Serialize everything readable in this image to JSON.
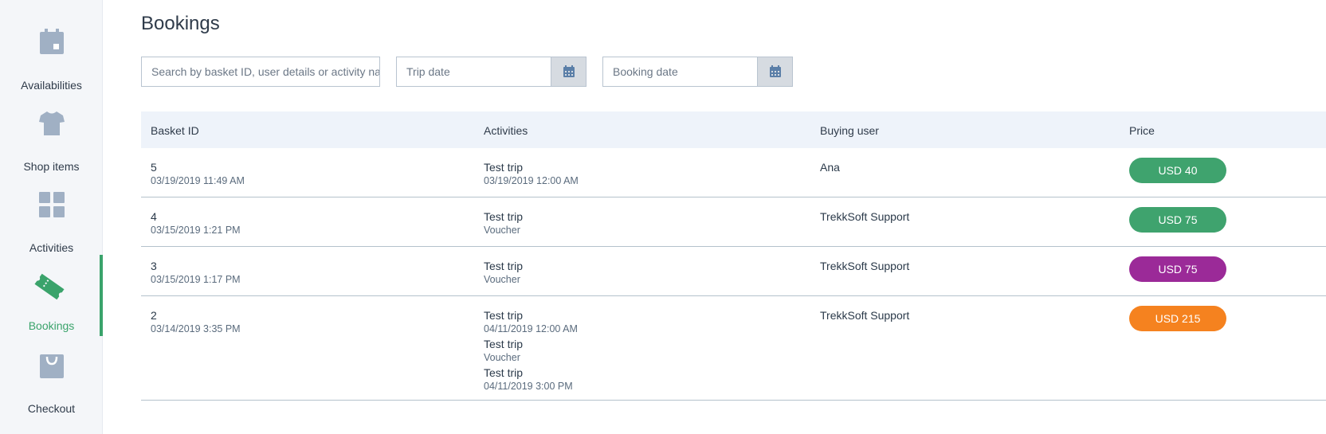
{
  "sidebar": {
    "items": [
      {
        "label": "Availabilities",
        "icon": "calendar-icon"
      },
      {
        "label": "Shop items",
        "icon": "tshirt-icon"
      },
      {
        "label": "Activities",
        "icon": "grid-icon"
      },
      {
        "label": "Bookings",
        "icon": "ticket-icon",
        "active": true
      },
      {
        "label": "Checkout",
        "icon": "shopping-bag-icon"
      }
    ],
    "active_color": "#3aa36b",
    "icon_color": "#a0b0c4"
  },
  "page": {
    "title": "Bookings"
  },
  "filters": {
    "search_placeholder": "Search by basket ID, user details or activity name",
    "trip_date_placeholder": "Trip date",
    "booking_date_placeholder": "Booking date"
  },
  "table": {
    "headers": [
      "Basket ID",
      "Activities",
      "Buying user",
      "Price"
    ],
    "rows": [
      {
        "id": "5",
        "date": "03/19/2019 11:49 AM",
        "activities": [
          {
            "name": "Test trip",
            "detail": "03/19/2019 12:00 AM"
          }
        ],
        "user": "Ana",
        "price": "USD 40",
        "price_color": "#3fa36e"
      },
      {
        "id": "4",
        "date": "03/15/2019 1:21 PM",
        "activities": [
          {
            "name": "Test trip",
            "detail": "Voucher"
          }
        ],
        "user": "TrekkSoft Support",
        "price": "USD 75",
        "price_color": "#3fa36e"
      },
      {
        "id": "3",
        "date": "03/15/2019 1:17 PM",
        "activities": [
          {
            "name": "Test trip",
            "detail": "Voucher"
          }
        ],
        "user": "TrekkSoft Support",
        "price": "USD 75",
        "price_color": "#9b2a98"
      },
      {
        "id": "2",
        "date": "03/14/2019 3:35 PM",
        "activities": [
          {
            "name": "Test trip",
            "detail": "04/11/2019 12:00 AM"
          },
          {
            "name": "Test trip",
            "detail": "Voucher"
          },
          {
            "name": "Test trip",
            "detail": "04/11/2019 3:00 PM"
          }
        ],
        "user": "TrekkSoft Support",
        "price": "USD 215",
        "price_color": "#f5821f"
      }
    ]
  }
}
